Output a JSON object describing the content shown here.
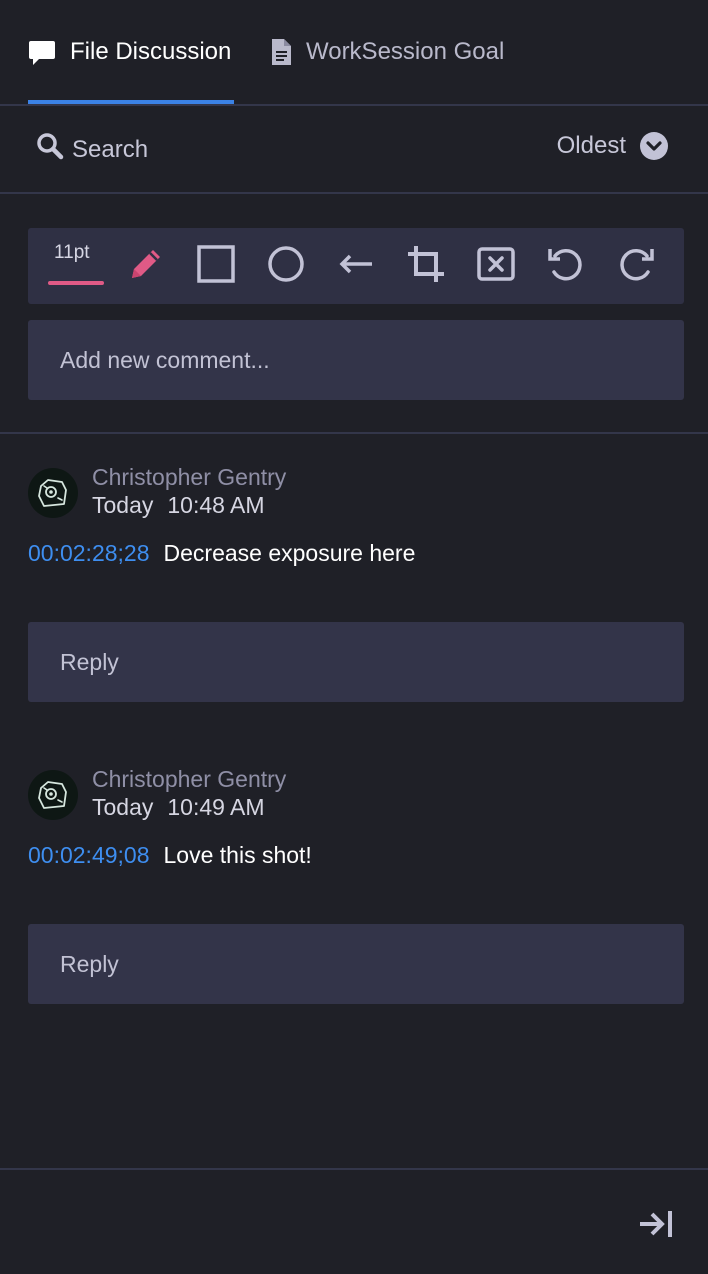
{
  "tabs": {
    "discussion": {
      "label": "File Discussion",
      "icon": "comment-bubble-icon",
      "active": true
    },
    "goal": {
      "label": "WorkSession Goal",
      "icon": "document-icon",
      "active": false
    }
  },
  "search": {
    "label": "Search",
    "icon": "search-icon"
  },
  "sort": {
    "label": "Oldest",
    "icon": "chevron-down-circle-icon"
  },
  "toolbar": {
    "size_label": "11pt",
    "accent": "#e05a86",
    "tools": [
      "pencil-icon",
      "rectangle-icon",
      "circle-icon",
      "arrow-icon",
      "crop-icon",
      "clear-icon",
      "undo-icon",
      "redo-icon"
    ]
  },
  "new_comment": {
    "placeholder": "Add new comment..."
  },
  "comments": [
    {
      "author": "Christopher Gentry",
      "day": "Today",
      "time": "10:48 AM",
      "timecode": "00:02:28;28",
      "text": "Decrease exposure here",
      "reply_placeholder": "Reply"
    },
    {
      "author": "Christopher Gentry",
      "day": "Today",
      "time": "10:49 AM",
      "timecode": "00:02:49;08",
      "text": "Love this shot!",
      "reply_placeholder": "Reply"
    }
  ],
  "colors": {
    "background": "#1f2027",
    "surface": "#333449",
    "tab_accent": "#3b82e6",
    "timecode": "#3e8ef0"
  },
  "footer": {
    "icon": "collapse-panel-icon"
  }
}
